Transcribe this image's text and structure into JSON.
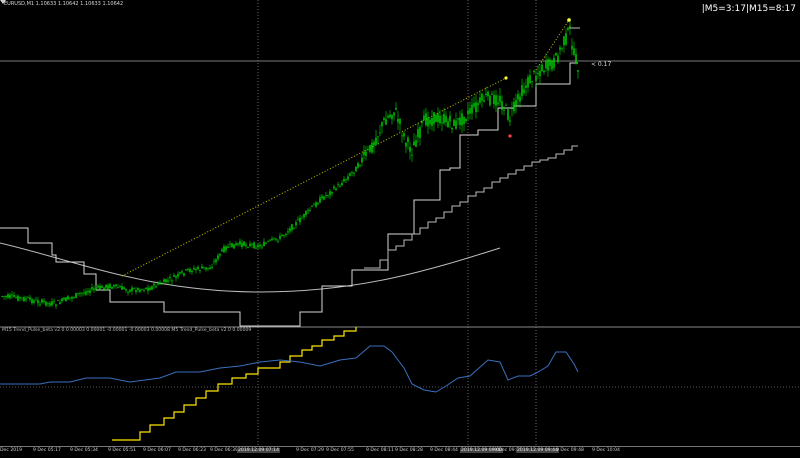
{
  "header": {
    "symbol": "EURUSD,M1  1.10633 1.10642 1.10633 1.10642",
    "tf_status": "|M5=3:17|M15=8:17",
    "price_tag": "< 0.17"
  },
  "indicator": {
    "legend": "M15 Trend_Pulse_beta v2.0 0.00003 0.00001 -0.00001 -0.00003 0.00008  M5 Trend_Pulse_beta v2.0 0.00009"
  },
  "time_axis": {
    "ticks": [
      {
        "t": "Dec 2019",
        "hl": false
      },
      {
        "t": "9 Dec 05:17",
        "hl": false
      },
      {
        "t": "9 Dec 05:34",
        "hl": false
      },
      {
        "t": "9 Dec 05:51",
        "hl": false
      },
      {
        "t": "9 Dec 06:07",
        "hl": false
      },
      {
        "t": "9 Dec 06:23",
        "hl": false
      },
      {
        "t": "9 Dec 06:39",
        "hl": false
      },
      {
        "t": "2019.12.09 07:14",
        "hl": true
      },
      {
        "t": "9 Dec 07:29",
        "hl": false
      },
      {
        "t": "9 Dec 07:55",
        "hl": false
      },
      {
        "t": "9 Dec 08:11",
        "hl": false
      },
      {
        "t": "9 Dec 08:28",
        "hl": false
      },
      {
        "t": "9 Dec 08:44",
        "hl": false
      },
      {
        "t": "2019.12.09 09:00",
        "hl": true
      },
      {
        "t": "9 Dec 09:16",
        "hl": false
      },
      {
        "t": "2019.12.09 09:44",
        "hl": true
      },
      {
        "t": "9 Dec 09:48",
        "hl": false
      },
      {
        "t": "9 Dec 10:04",
        "hl": false
      }
    ]
  },
  "colors": {
    "background": "#000000",
    "candle": "#00e000",
    "stepline": "#d0d0d0",
    "trendline": "#ffff00",
    "ind_yellow": "#ffe600",
    "ind_blue": "#3a6fbf",
    "grid": "#666666"
  }
}
